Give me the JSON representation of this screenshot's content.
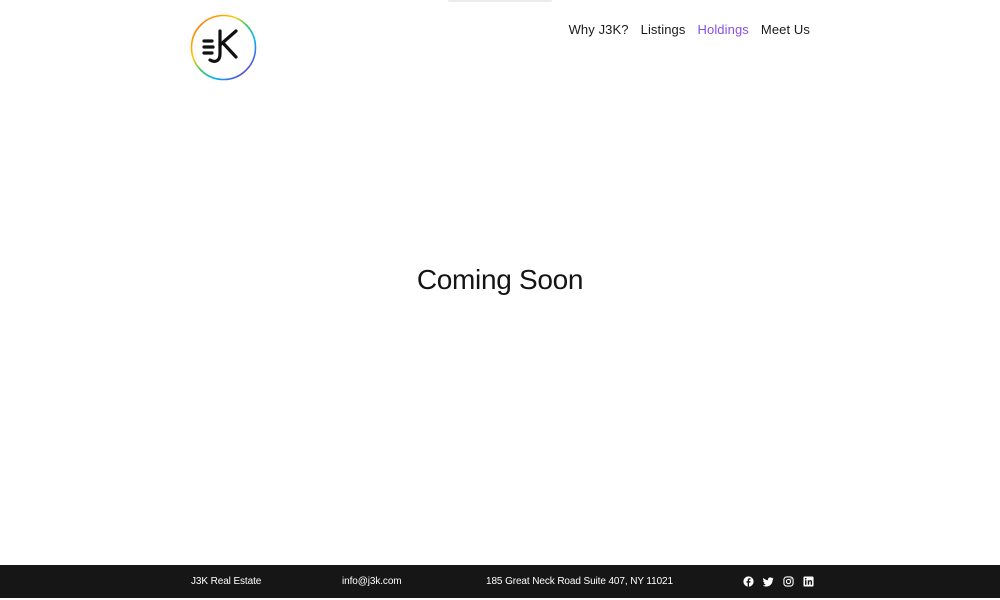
{
  "brand": {
    "logo_icon": "j3k-logo-icon",
    "logo_text": "J3K",
    "ring_colors": [
      "#ff3b30",
      "#ff9500",
      "#ffcc00",
      "#34c759",
      "#00b4ff",
      "#5856d6",
      "#af52de"
    ]
  },
  "nav": {
    "items": [
      {
        "label": "Why J3K?",
        "active": false
      },
      {
        "label": "Listings",
        "active": false
      },
      {
        "label": "Holdings",
        "active": true
      },
      {
        "label": "Meet Us",
        "active": false
      }
    ],
    "active_color": "#8a4fe3"
  },
  "main": {
    "headline": "Coming Soon"
  },
  "footer": {
    "company": "J3K Real Estate",
    "email": "info@j3k.com",
    "address": "185 Great Neck Road Suite 407, NY 11021",
    "socials": [
      "facebook-icon",
      "twitter-icon",
      "instagram-icon",
      "linkedin-icon"
    ],
    "background": "#161616"
  }
}
